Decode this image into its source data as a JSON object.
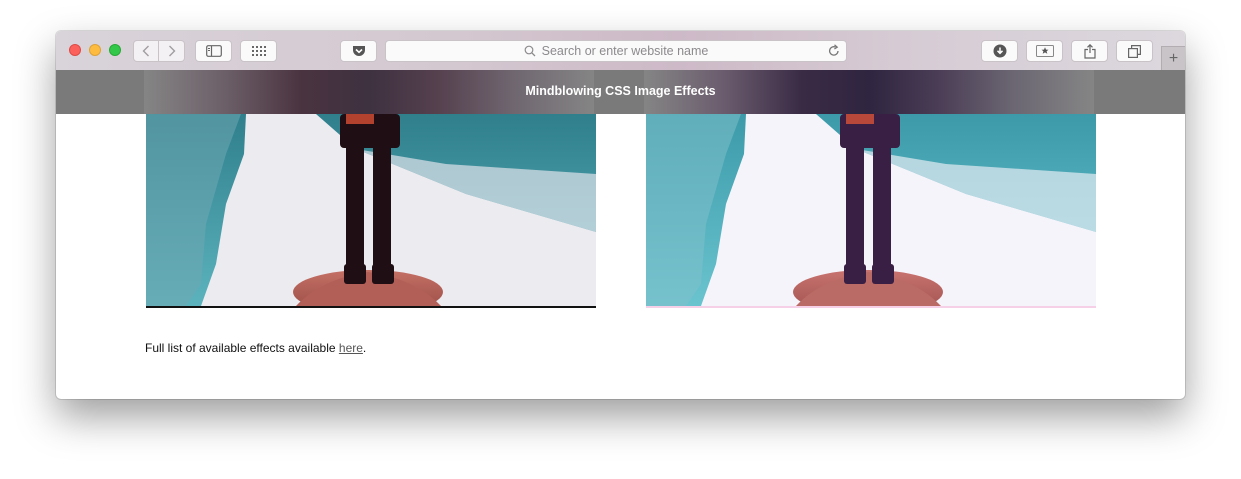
{
  "browser": {
    "address_placeholder": "Search or enter website name",
    "nav_icons": [
      "back-icon",
      "forward-icon"
    ],
    "toolbar_icons": [
      "sidebar-icon",
      "top-sites-icon",
      "pocket-icon",
      "download-icon",
      "bookmark-icon",
      "share-icon",
      "tabs-icon",
      "new-tab-icon"
    ]
  },
  "page": {
    "title": "Mindblowing CSS Image Effects",
    "caption_prefix": "Full list of available effects available ",
    "caption_link": "here",
    "caption_suffix": "."
  },
  "images": [
    {
      "effect": "original",
      "water_color": "#3d9aa7",
      "accent_border": "#111111"
    },
    {
      "effect": "filtered",
      "water_color": "#4fb0c0",
      "accent_border": "#f6d0e6"
    }
  ]
}
